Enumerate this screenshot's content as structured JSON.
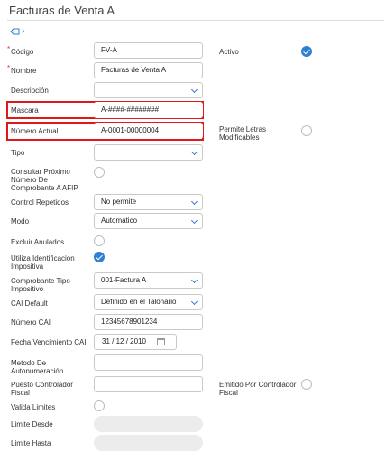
{
  "header": {
    "title": "Facturas de Venta A"
  },
  "form": {
    "codigo": {
      "label": "Código",
      "value": "FV-A"
    },
    "nombre": {
      "label": "Nombre",
      "value": "Facturas de Venta A"
    },
    "descripcion": {
      "label": "Descripción",
      "value": ""
    },
    "mascara": {
      "label": "Mascara",
      "value": "A-####-########"
    },
    "numero_actual": {
      "label": "Número Actual",
      "value": "A-0001-00000004"
    },
    "tipo": {
      "label": "Tipo",
      "value": ""
    },
    "consultar": {
      "label": "Consultar Próximo Número De Comprobante A AFIP"
    },
    "control_repetidos": {
      "label": "Control Repetidos",
      "value": "No permite"
    },
    "modo": {
      "label": "Modo",
      "value": "Automático"
    },
    "excluir_anulados": {
      "label": "Excluir Anulados"
    },
    "utiliza_identificacion": {
      "label": "Utiliza Identificacion Impositiva"
    },
    "comprobante_tipo": {
      "label": "Comprobante Tipo Impositivo",
      "value": "001-Factura A"
    },
    "cai_default": {
      "label": "CAI Default",
      "value": "Definido en el Talonario"
    },
    "numero_cai": {
      "label": "Número CAI",
      "value": "12345678901234"
    },
    "fecha_vencimiento_cai": {
      "label": "Fecha Vencimiento CAI",
      "value": "31 / 12 / 2010"
    },
    "metodo_autonumeracion": {
      "label": "Metodo De Autonumeración",
      "value": ""
    },
    "puesto_controlador": {
      "label": "Puesto Controlador Fiscal",
      "value": ""
    },
    "valida_limites": {
      "label": "Valida Limites"
    },
    "limite_desde": {
      "label": "Limite Desde",
      "value": ""
    },
    "limite_hasta": {
      "label": "Limite Hasta",
      "value": ""
    },
    "activo": {
      "label": "Activo"
    },
    "permite_letras": {
      "label": "Permite Letras Modificables"
    },
    "emitido_controlador": {
      "label": "Emitido Por Controlador Fiscal"
    },
    "required_mark": "*"
  },
  "colors": {
    "accent": "#2f80d1",
    "highlight": "#e01818",
    "required": "#e03030"
  }
}
